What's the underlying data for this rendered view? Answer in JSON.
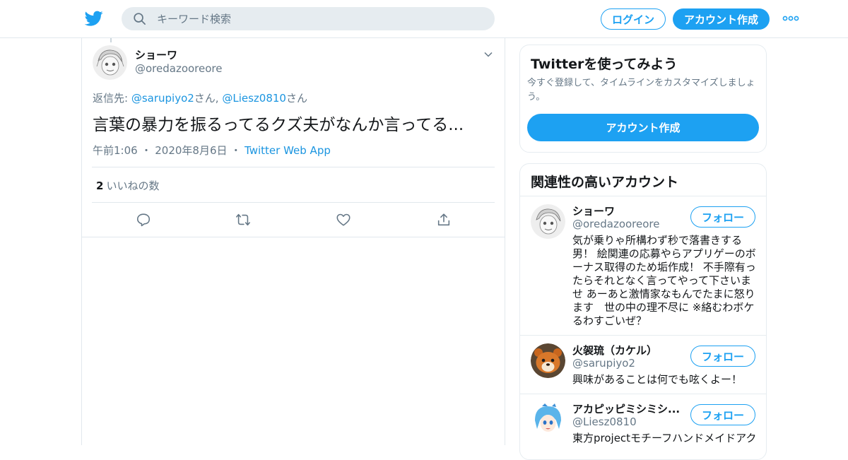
{
  "header": {
    "search_placeholder": "キーワード検索",
    "login_label": "ログイン",
    "signup_label": "アカウント作成",
    "brand_color": "#1da1f2"
  },
  "tweet": {
    "author_name": "ショーワ",
    "author_handle": "@oredazooreore",
    "reply_prefix": "返信先: ",
    "reply_user1": "@sarupiyo2",
    "reply_san1": "さん, ",
    "reply_user2": "@Liesz0810",
    "reply_san2": "さん",
    "text": "言葉の暴力を振るってるクズ夫がなんか言ってる...",
    "time": "午前1:06",
    "date": "2020年8月6日",
    "via": "Twitter Web App",
    "likes_count": "2",
    "likes_label": "いいねの数"
  },
  "signup_card": {
    "title": "Twitterを使ってみよう",
    "description": "今すぐ登録して、タイムラインをカスタマイズしましょう。",
    "button_label": "アカウント作成"
  },
  "related": {
    "title": "関連性の高いアカウント",
    "follow_label": "フォロー",
    "accounts": [
      {
        "name": "ショーワ",
        "handle": "@oredazooreore",
        "bio": "気が乗りゃ所構わず秒で落書きする男！ 絵関連の応募やらアプリゲーのボーナス取得のため垢作成！ 不手際有ったらそれとなく言ってやって下さいませ あーあと激情家なもんでたまに怒ります　世の中の理不尽に ※絡むわボケるわすごいぜ？"
      },
      {
        "name": "火袈琉（カケル）",
        "handle": "@sarupiyo2",
        "bio": "興味があることは何でも呟くよー！"
      },
      {
        "name": "アカピッピミシミシ...",
        "handle": "@Liesz0810",
        "bio": "東方projectモチーフハンドメイドアク"
      }
    ]
  }
}
